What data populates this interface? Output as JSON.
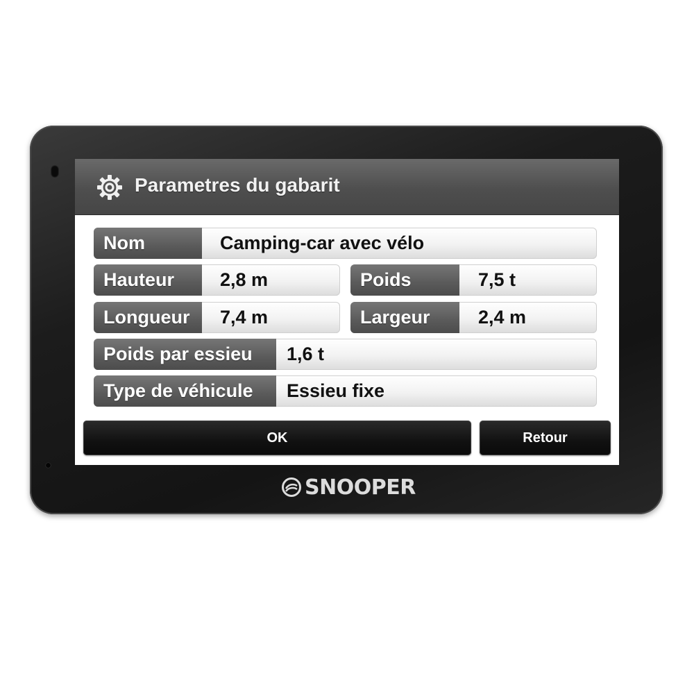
{
  "title": "Parametres du gabarit",
  "rows": {
    "nom": {
      "label": "Nom",
      "value": "Camping-car avec vélo"
    },
    "hauteur": {
      "label": "Hauteur",
      "value": "2,8 m"
    },
    "poids": {
      "label": "Poids",
      "value": "7,5 t"
    },
    "longueur": {
      "label": "Longueur",
      "value": "7,4 m"
    },
    "largeur": {
      "label": "Largeur",
      "value": "2,4 m"
    },
    "poids_essieu": {
      "label": "Poids par essieu",
      "value": "1,6 t"
    },
    "type_vehicule": {
      "label": "Type de véhicule",
      "value": "Essieu fixe"
    }
  },
  "buttons": {
    "ok": "OK",
    "retour": "Retour"
  },
  "brand": "SNOOPER",
  "icons": {
    "title": "gear-icon",
    "brand": "snooper-logo-icon"
  }
}
